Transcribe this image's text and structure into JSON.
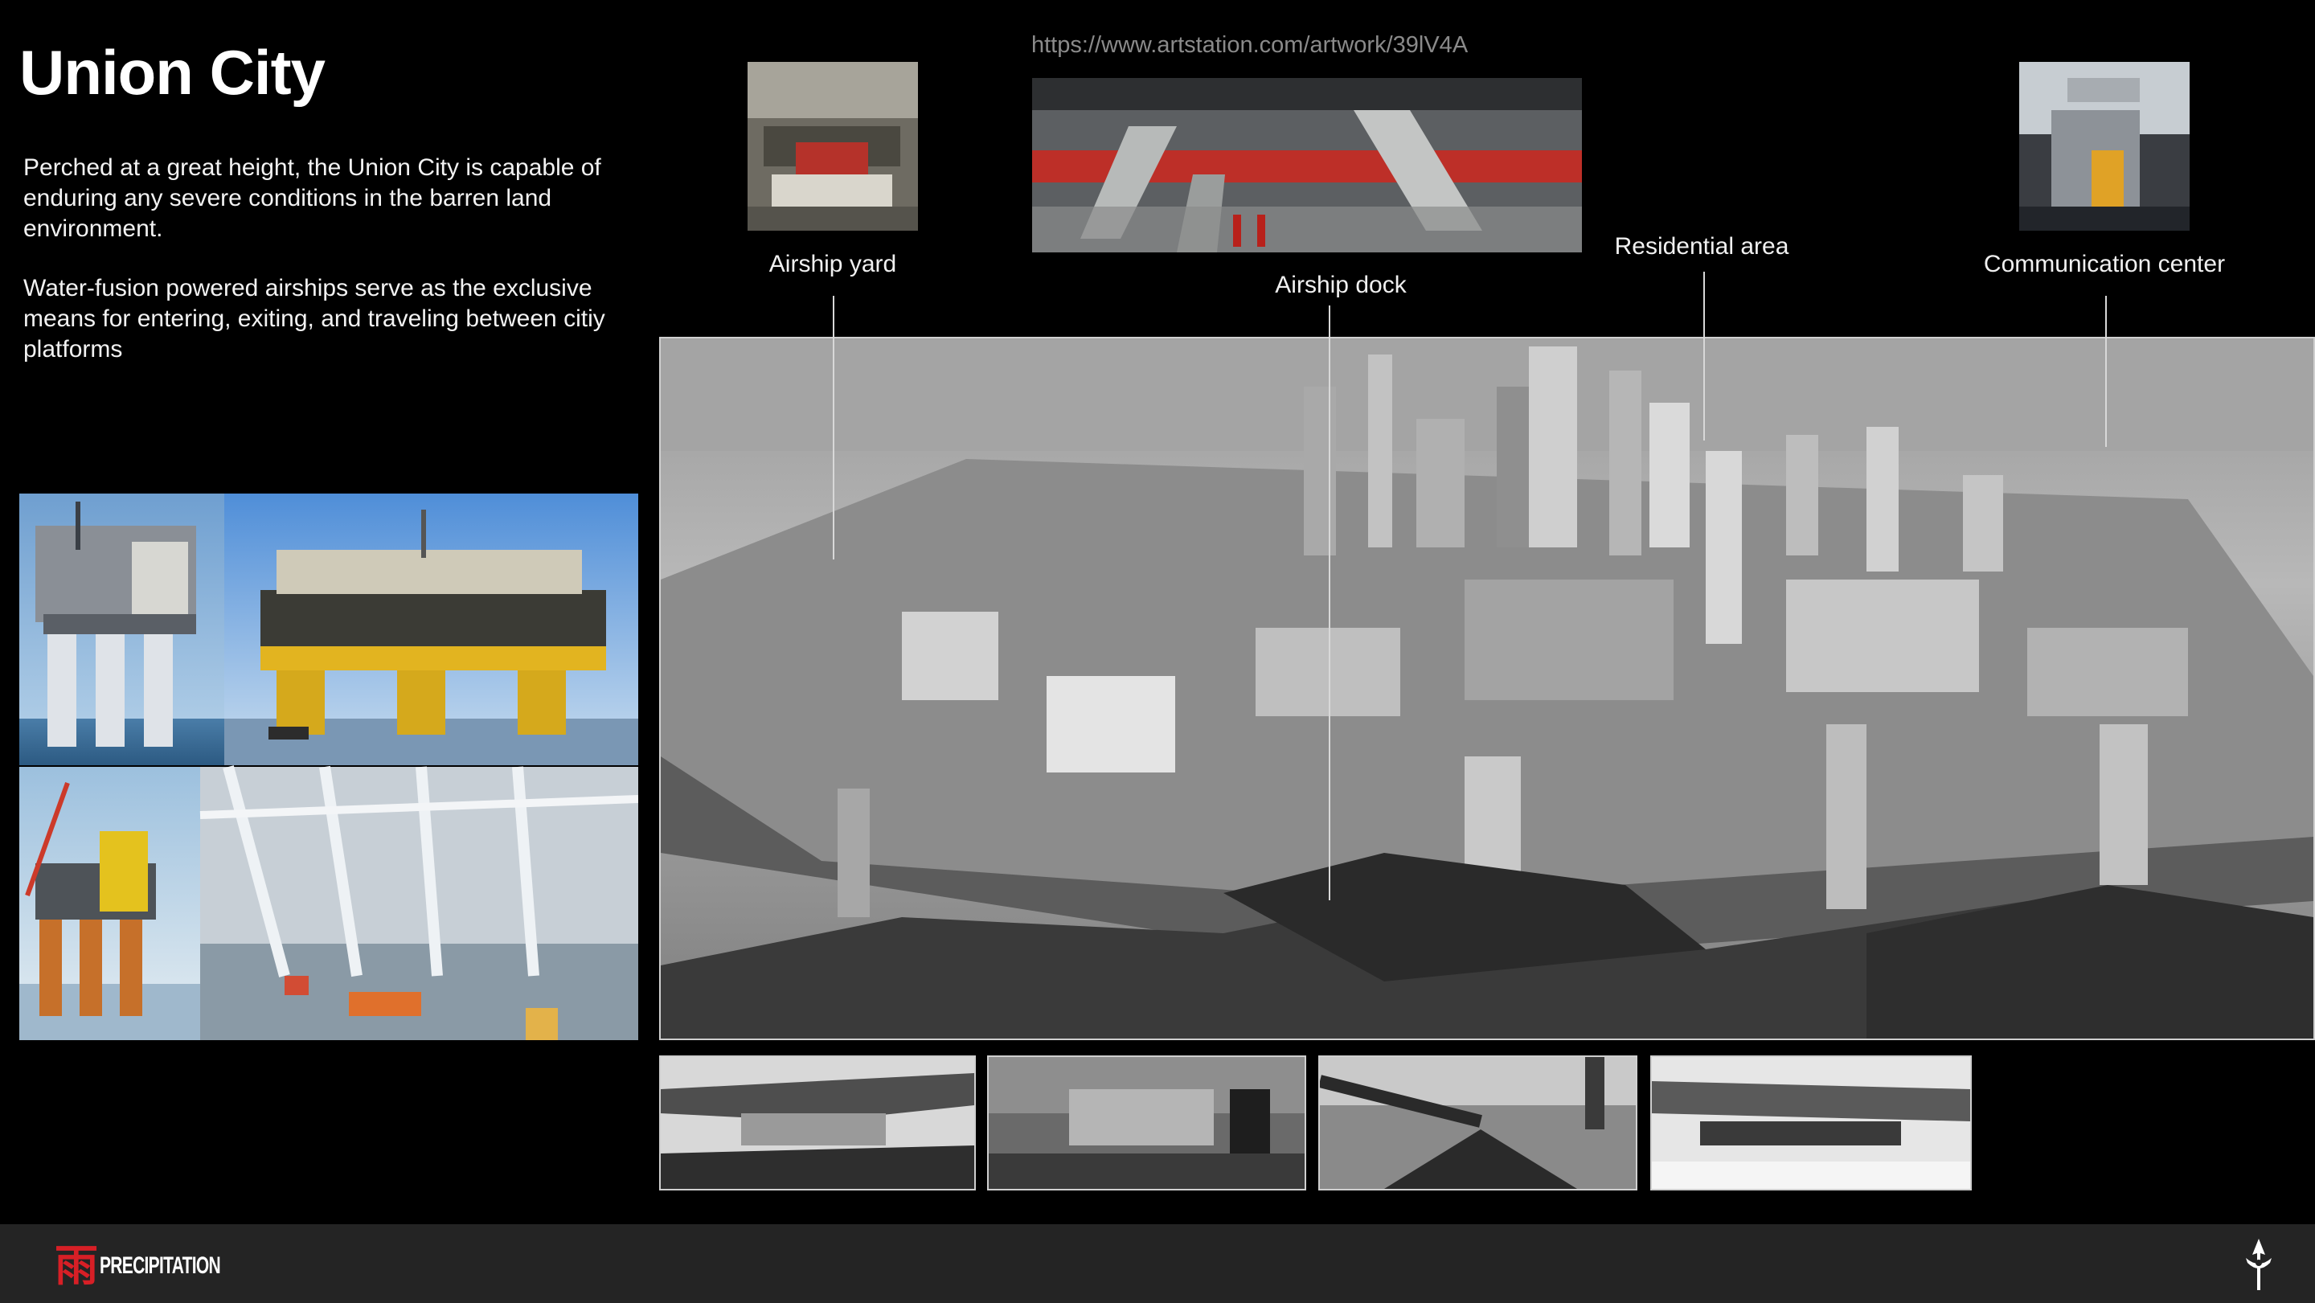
{
  "page": {
    "title": "Union City",
    "paragraphs": [
      "Perched at a great height, the Union City is capable of enduring any severe conditions in the barren land environment.",
      "Water-fusion powered airships serve as the exclusive means for entering, exiting, and traveling between citiy platforms"
    ],
    "source_url": "https://www.artstation.com/artwork/39lV4A"
  },
  "callouts": [
    {
      "label": "Airship yard"
    },
    {
      "label": "Airship dock"
    },
    {
      "label": "Residential area"
    },
    {
      "label": "Communication center"
    }
  ],
  "footer": {
    "logo_glyph": "雨",
    "logo_text": "PRECIPITATION"
  },
  "colors": {
    "background": "#000000",
    "footer": "#242424",
    "logo_red": "#d71f26",
    "url_gray": "#8a8a8a"
  }
}
